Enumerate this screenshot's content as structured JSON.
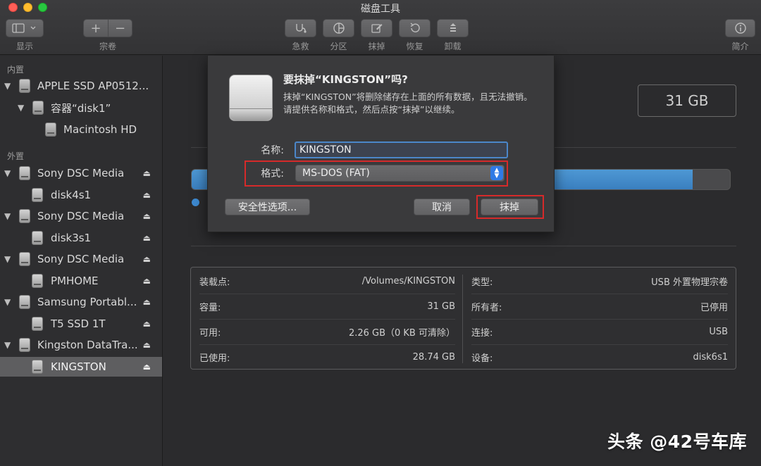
{
  "window": {
    "title": "磁盘工具"
  },
  "toolbar": {
    "display_label": "显示",
    "volume_label": "宗卷",
    "add_symbol": "+",
    "remove_symbol": "−",
    "first_aid_label": "急救",
    "partition_label": "分区",
    "erase_label": "抹掉",
    "restore_label": "恢复",
    "unmount_label": "卸载",
    "info_label": "简介"
  },
  "sidebar": {
    "internal_header": "内置",
    "external_header": "外置",
    "internal_items": [
      {
        "label": "APPLE SSD AP0512...",
        "icon": "internal-disk-icon"
      },
      {
        "label": "容器“disk1”",
        "icon": "internal-disk-icon"
      },
      {
        "label": "Macintosh HD",
        "icon": "internal-disk-icon"
      }
    ],
    "external_items": [
      {
        "label": "Sony DSC Media",
        "icon": "external-disk-icon"
      },
      {
        "label": "disk4s1",
        "icon": "external-disk-icon"
      },
      {
        "label": "Sony DSC Media",
        "icon": "external-disk-icon"
      },
      {
        "label": "disk3s1",
        "icon": "external-disk-icon"
      },
      {
        "label": "Sony DSC Media",
        "icon": "external-disk-icon"
      },
      {
        "label": "PMHOME",
        "icon": "external-disk-icon"
      },
      {
        "label": "Samsung Portabl...",
        "icon": "external-disk-icon"
      },
      {
        "label": "T5 SSD 1T",
        "icon": "external-disk-icon"
      },
      {
        "label": "Kingston DataTra...",
        "icon": "external-disk-icon"
      },
      {
        "label": "KINGSTON",
        "icon": "external-disk-icon",
        "selected": true
      }
    ]
  },
  "main": {
    "capacity": "31 GB",
    "usage_fraction": 0.93,
    "info": {
      "left": [
        {
          "key": "装载点:",
          "value": "/Volumes/KINGSTON"
        },
        {
          "key": "容量:",
          "value": "31 GB"
        },
        {
          "key": "可用:",
          "value": "2.26 GB（0 KB 可清除）"
        },
        {
          "key": "已使用:",
          "value": "28.74 GB"
        }
      ],
      "right": [
        {
          "key": "类型:",
          "value": "USB 外置物理宗卷"
        },
        {
          "key": "所有者:",
          "value": "已停用"
        },
        {
          "key": "连接:",
          "value": "USB"
        },
        {
          "key": "设备:",
          "value": "disk6s1"
        }
      ]
    }
  },
  "dialog": {
    "title": "要抹掉“KINGSTON”吗?",
    "description": "抹掉“KINGSTON”将删除储存在上面的所有数据，且无法撤销。请提供名称和格式，然后点按“抹掉”以继续。",
    "name_label": "名称:",
    "name_value": "KINGSTON",
    "format_label": "格式:",
    "format_value": "MS-DOS (FAT)",
    "security_button": "安全性选项...",
    "cancel_button": "取消",
    "erase_button": "抹掉"
  },
  "watermark": "头条 @42号车库",
  "colors": {
    "accent": "#2f7ae5",
    "highlight_box": "#d62a2a",
    "usage_fill": "#3d89d0"
  }
}
